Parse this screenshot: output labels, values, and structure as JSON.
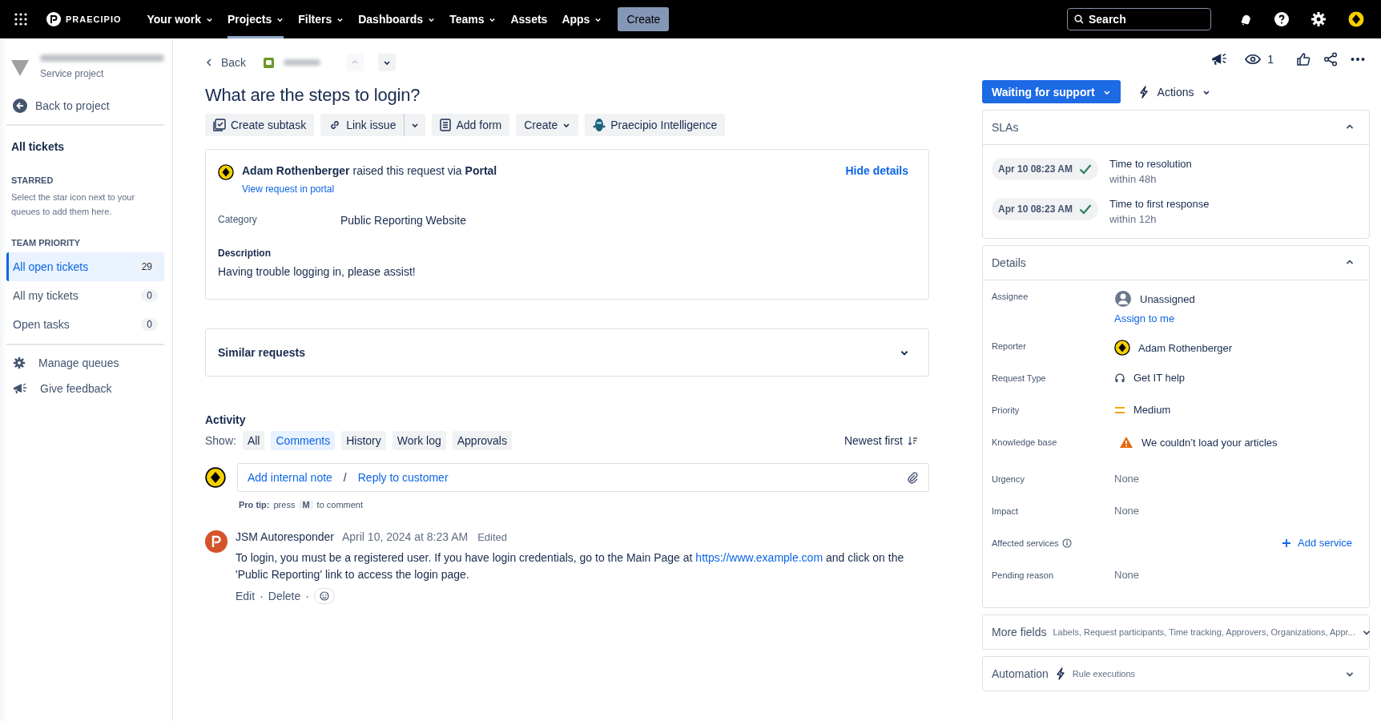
{
  "topnav": {
    "logo": "PRAECIPIO",
    "items": [
      {
        "label": "Your work",
        "dropdown": true,
        "selected": false
      },
      {
        "label": "Projects",
        "dropdown": true,
        "selected": true
      },
      {
        "label": "Filters",
        "dropdown": true,
        "selected": false
      },
      {
        "label": "Dashboards",
        "dropdown": true,
        "selected": false
      },
      {
        "label": "Teams",
        "dropdown": true,
        "selected": false
      },
      {
        "label": "Assets",
        "dropdown": false,
        "selected": false
      },
      {
        "label": "Apps",
        "dropdown": true,
        "selected": false
      }
    ],
    "create": "Create",
    "search": {
      "placeholder": "Search"
    }
  },
  "sidebar": {
    "project_type": "Service project",
    "back": "Back to project",
    "heading": "All tickets",
    "starred": {
      "title": "STARRED",
      "hint": "Select the star icon next to your queues to add them here."
    },
    "team_priority": {
      "title": "TEAM PRIORITY",
      "queues": [
        {
          "label": "All open tickets",
          "count": "29",
          "selected": true
        },
        {
          "label": "All my tickets",
          "count": "0",
          "selected": false
        },
        {
          "label": "Open tasks",
          "count": "0",
          "selected": false
        }
      ]
    },
    "footer_items": [
      {
        "label": "Manage queues",
        "kind": "gear"
      },
      {
        "label": "Give feedback",
        "kind": "megaphone"
      }
    ]
  },
  "issue": {
    "back": "Back",
    "title": "What are the steps to login?",
    "toolbar": [
      {
        "label": "Create subtask",
        "kind": "subtask"
      },
      {
        "label": "Link issue",
        "kind": "link"
      },
      {
        "label": "Add form",
        "kind": "form"
      },
      {
        "label": "Create",
        "kind": "create"
      },
      {
        "label": "Praecipio Intelligence",
        "kind": "ai"
      }
    ],
    "request": {
      "raised": "**Adam Rothenberger** raised this request via **Portal**",
      "view_link": "View request in portal",
      "hide": "Hide details",
      "fields": [
        {
          "label": "Category",
          "value": "Public Reporting Website"
        }
      ],
      "description": {
        "label": "Description",
        "text": "Having trouble logging in, please assist!"
      }
    },
    "similar": {
      "title": "Similar requests",
      "expanded": false
    }
  },
  "activity": {
    "title": "Activity",
    "show_label": "Show:",
    "filters": [
      {
        "label": "All",
        "selected": false
      },
      {
        "label": "Comments",
        "selected": true
      },
      {
        "label": "History",
        "selected": false
      },
      {
        "label": "Work log",
        "selected": false
      },
      {
        "label": "Approvals",
        "selected": false
      }
    ],
    "sort": "Newest first",
    "comment_box": {
      "internal": "Add internal note",
      "separator": "/",
      "reply": "Reply to customer"
    },
    "pro_tip": {
      "label": "Pro tip:",
      "before": "press",
      "key": "M",
      "after": "to comment"
    },
    "comments": [
      {
        "author": "JSM Autoresponder",
        "date": "April 10, 2024 at 8:23 AM",
        "edited": true,
        "edited_label": "Edited",
        "text_before": "To login, you must be a registered user. If you have login credentials, go to the Main Page at",
        "link": "https://www.example.com",
        "text_after": "and click on the 'Public Reporting' link to access the login page.",
        "actions": [
          "Edit",
          "Delete"
        ],
        "action_separator": "·"
      }
    ]
  },
  "right": {
    "watch_count": "1",
    "status": "Waiting for support",
    "actions": "Actions",
    "slas": {
      "title": "SLAs",
      "expanded": true,
      "items": [
        {
          "time": "Apr 10 08:23 AM",
          "met": true,
          "name": "Time to resolution",
          "goal": "within 48h"
        },
        {
          "time": "Apr 10 08:23 AM",
          "met": true,
          "name": "Time to first response",
          "goal": "within 12h"
        }
      ]
    },
    "details": {
      "title": "Details",
      "expanded": true,
      "fields": [
        {
          "label": "Assignee",
          "kind": "unassigned",
          "value": "Unassigned",
          "link": "Assign to me"
        },
        {
          "label": "Reporter",
          "kind": "user",
          "value": "Adam Rothenberger"
        },
        {
          "label": "Request Type",
          "kind": "request_type",
          "value": "Get IT help"
        },
        {
          "label": "Priority",
          "kind": "priority",
          "value": "Medium"
        },
        {
          "label": "Knowledge base",
          "kind": "warning",
          "value": "We couldn’t load your articles"
        },
        {
          "label": "Urgency",
          "kind": "none",
          "value": "None"
        },
        {
          "label": "Impact",
          "kind": "none",
          "value": "None"
        },
        {
          "label": "Affected services",
          "kind": "add",
          "value": "Add service"
        },
        {
          "label": "Pending reason",
          "kind": "none",
          "value": "None"
        }
      ]
    },
    "more_fields": {
      "title": "More fields",
      "summary": "Labels, Request participants, Time tracking, Approvers, Organizations, Appr...",
      "expanded": false
    },
    "automation": {
      "title": "Automation",
      "subtitle": "Rule executions",
      "expanded": false
    }
  }
}
